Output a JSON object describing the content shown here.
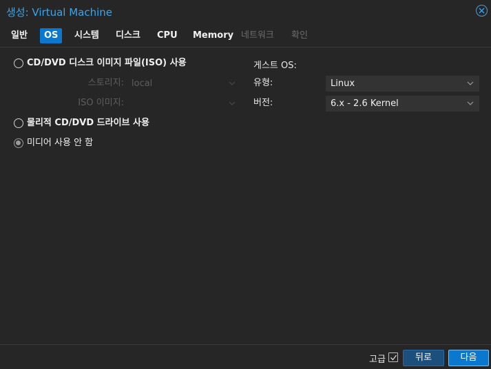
{
  "window": {
    "title": "생성: Virtual Machine"
  },
  "tabs": [
    {
      "label": "일반",
      "state": "normal"
    },
    {
      "label": "OS",
      "state": "active"
    },
    {
      "label": "시스템",
      "state": "normal"
    },
    {
      "label": "디스크",
      "state": "normal"
    },
    {
      "label": "CPU",
      "state": "normal"
    },
    {
      "label": "Memory",
      "state": "normal"
    },
    {
      "label": "네트워크",
      "state": "disabled"
    },
    {
      "label": "확인",
      "state": "disabled"
    }
  ],
  "media": {
    "iso_option": {
      "label": "CD/DVD 디스크 이미지 파일(ISO) 사용",
      "checked": false
    },
    "storage": {
      "label": "스토리지:",
      "value": "local"
    },
    "iso_image": {
      "label": "ISO 이미지:",
      "value": ""
    },
    "physical_option": {
      "label": "물리적 CD/DVD 드라이브 사용",
      "checked": false
    },
    "none_option": {
      "label": "미디어 사용 안 함",
      "checked": true
    }
  },
  "guest_os": {
    "heading": "게스트 OS:",
    "type": {
      "label": "유형:",
      "value": "Linux"
    },
    "version": {
      "label": "버전:",
      "value": "6.x - 2.6 Kernel"
    }
  },
  "footer": {
    "advanced_label": "고급",
    "advanced_checked": true,
    "back_label": "뒤로",
    "next_label": "다음"
  },
  "colors": {
    "accent": "#0b78d0",
    "title": "#3fa4e8",
    "background": "#262626",
    "field": "#333333"
  }
}
